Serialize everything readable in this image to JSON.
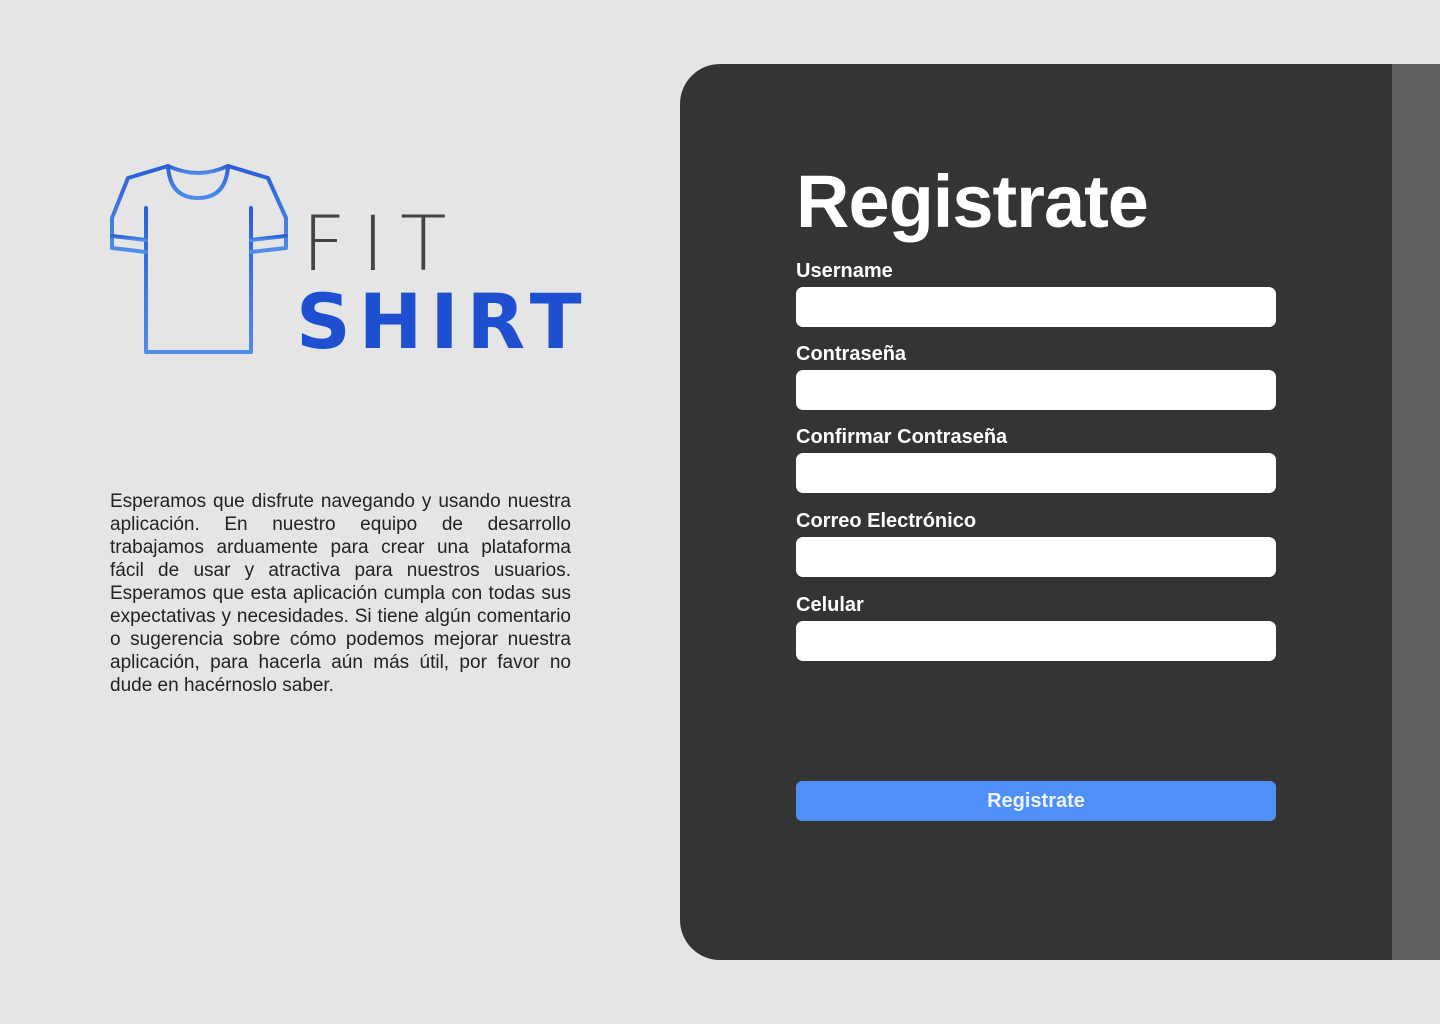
{
  "brand": {
    "word_top": "FIT",
    "word_bottom": "SHIRT",
    "icon": "tshirt-icon",
    "color_primary": "#1e4fd0",
    "color_text": "#444444"
  },
  "intro": {
    "text": "Esperamos que disfrute navegando y usando nuestra aplicación. En nuestro equipo de desarrollo trabajamos arduamente para crear una plataforma fácil de usar y atractiva para nuestros usuarios. Esperamos que esta aplicación cumpla con todas sus expectativas y necesidades. Si tiene algún comentario o sugerencia sobre cómo podemos mejorar nuestra aplicación, para hacerla aún más útil, por favor no dude en hacérnoslo saber."
  },
  "form": {
    "title": "Registrate",
    "fields": [
      {
        "label": "Username",
        "value": "",
        "placeholder": ""
      },
      {
        "label": "Contraseña",
        "value": "",
        "placeholder": ""
      },
      {
        "label": "Confirmar Contraseña",
        "value": "",
        "placeholder": ""
      },
      {
        "label": "Correo Electrónico",
        "value": "",
        "placeholder": ""
      },
      {
        "label": "Celular",
        "value": "",
        "placeholder": ""
      }
    ],
    "submit_label": "Registrate"
  },
  "colors": {
    "background": "#e5e5e5",
    "panel": "#343434",
    "scrollbar": "#616161",
    "button": "#4e90f8"
  }
}
